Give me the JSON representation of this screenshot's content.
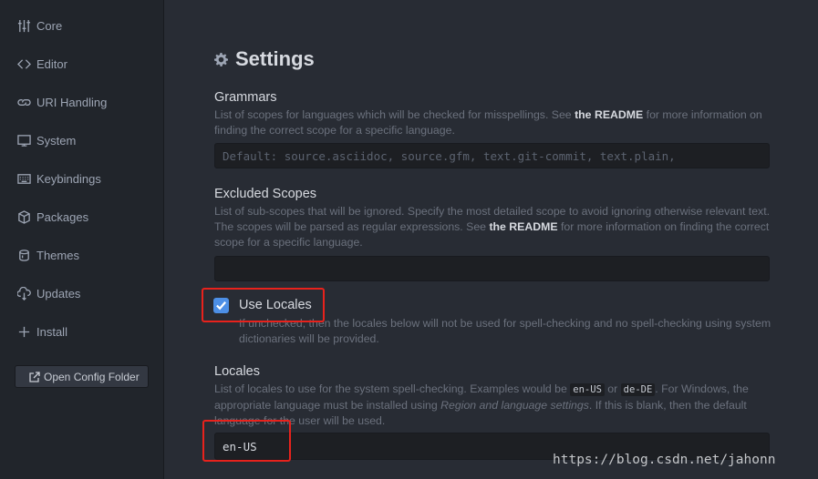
{
  "sidebar": {
    "items": [
      {
        "label": "Core",
        "icon": "sliders-icon"
      },
      {
        "label": "Editor",
        "icon": "code-icon"
      },
      {
        "label": "URI Handling",
        "icon": "link-icon"
      },
      {
        "label": "System",
        "icon": "monitor-icon"
      },
      {
        "label": "Keybindings",
        "icon": "keyboard-icon"
      },
      {
        "label": "Packages",
        "icon": "package-icon"
      },
      {
        "label": "Themes",
        "icon": "paintcan-icon"
      },
      {
        "label": "Updates",
        "icon": "cloud-download-icon"
      },
      {
        "label": "Install",
        "icon": "plus-icon"
      }
    ],
    "open_config_label": "Open Config Folder"
  },
  "main": {
    "title": "Settings",
    "grammars": {
      "title": "Grammars",
      "desc_pre": "List of scopes for languages which will be checked for misspellings. See ",
      "desc_link": "the README",
      "desc_post": " for more information on finding the correct scope for a specific language.",
      "placeholder": "Default: source.asciidoc, source.gfm, text.git-commit, text.plain,"
    },
    "excluded": {
      "title": "Excluded Scopes",
      "desc_pre": "List of sub-scopes that will be ignored. Specify the most detailed scope to avoid ignoring otherwise relevant text. The scopes will be parsed as regular expressions. See ",
      "desc_link": "the README",
      "desc_post": " for more information on finding the correct scope for a specific language.",
      "value": ""
    },
    "use_locales": {
      "label": "Use Locales",
      "checked": true,
      "desc": "If unchecked, then the locales below will not be used for spell-checking and no spell-checking using system dictionaries will be provided."
    },
    "locales": {
      "title": "Locales",
      "desc_1": "List of locales to use for the system spell-checking. Examples would be ",
      "code_1": "en-US",
      "desc_2": " or ",
      "code_2": "de-DE",
      "desc_3": ". For Windows, the appropriate language must be installed using ",
      "desc_italic": "Region and language settings",
      "desc_4": ". If this is blank, then the default language for the user will be used.",
      "value": "en-US"
    }
  },
  "watermark": "https://blog.csdn.net/jahonn",
  "colors": {
    "accent": "#4d8fe6",
    "highlight": "#e8221c",
    "bg": "#282c34",
    "sidebar_bg": "#21252b"
  }
}
